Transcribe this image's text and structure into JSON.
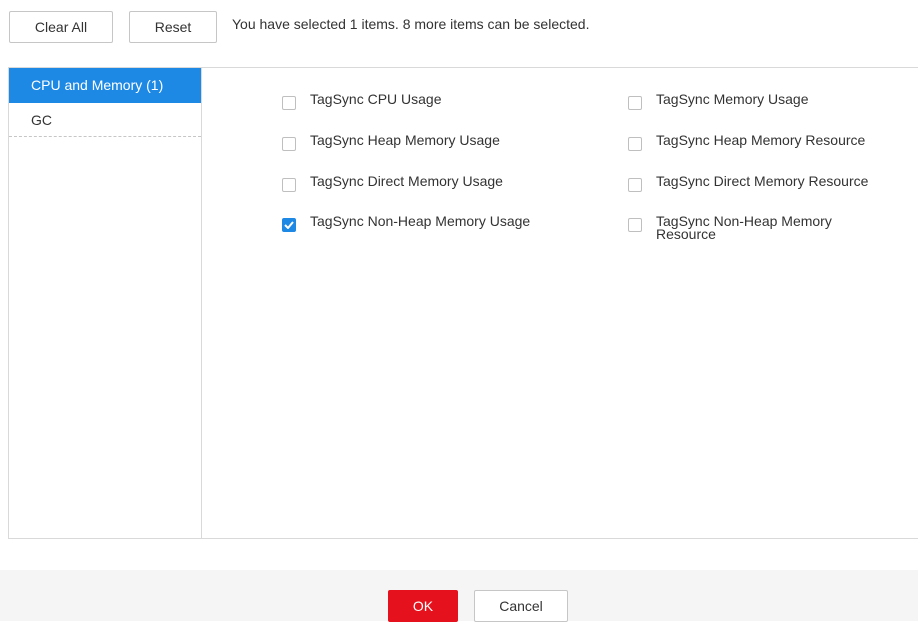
{
  "toolbar": {
    "clear_all_label": "Clear All",
    "reset_label": "Reset",
    "selection_hint": "You have selected 1 items. 8 more items can be selected."
  },
  "sidebar": {
    "items": [
      {
        "label": "CPU and Memory (1)",
        "active": true
      },
      {
        "label": "GC",
        "active": false
      }
    ]
  },
  "options": [
    {
      "label": "TagSync CPU Usage",
      "checked": false
    },
    {
      "label": "TagSync Memory Usage",
      "checked": false
    },
    {
      "label": "TagSync Heap Memory Usage",
      "checked": false
    },
    {
      "label": "TagSync Heap Memory Resource",
      "checked": false
    },
    {
      "label": "TagSync Direct Memory Usage",
      "checked": false
    },
    {
      "label": "TagSync Direct Memory Resource",
      "checked": false
    },
    {
      "label": "TagSync Non-Heap Memory Usage",
      "checked": true
    },
    {
      "label": "TagSync Non-Heap Memory Resource",
      "checked": false
    }
  ],
  "footer": {
    "ok_label": "OK",
    "cancel_label": "Cancel"
  },
  "colors": {
    "accent": "#1e88e5",
    "ok_button": "#e5121e",
    "footer_bg": "#f5f5f5"
  },
  "icons": {
    "checkbox_checked": "checkmark-icon"
  }
}
